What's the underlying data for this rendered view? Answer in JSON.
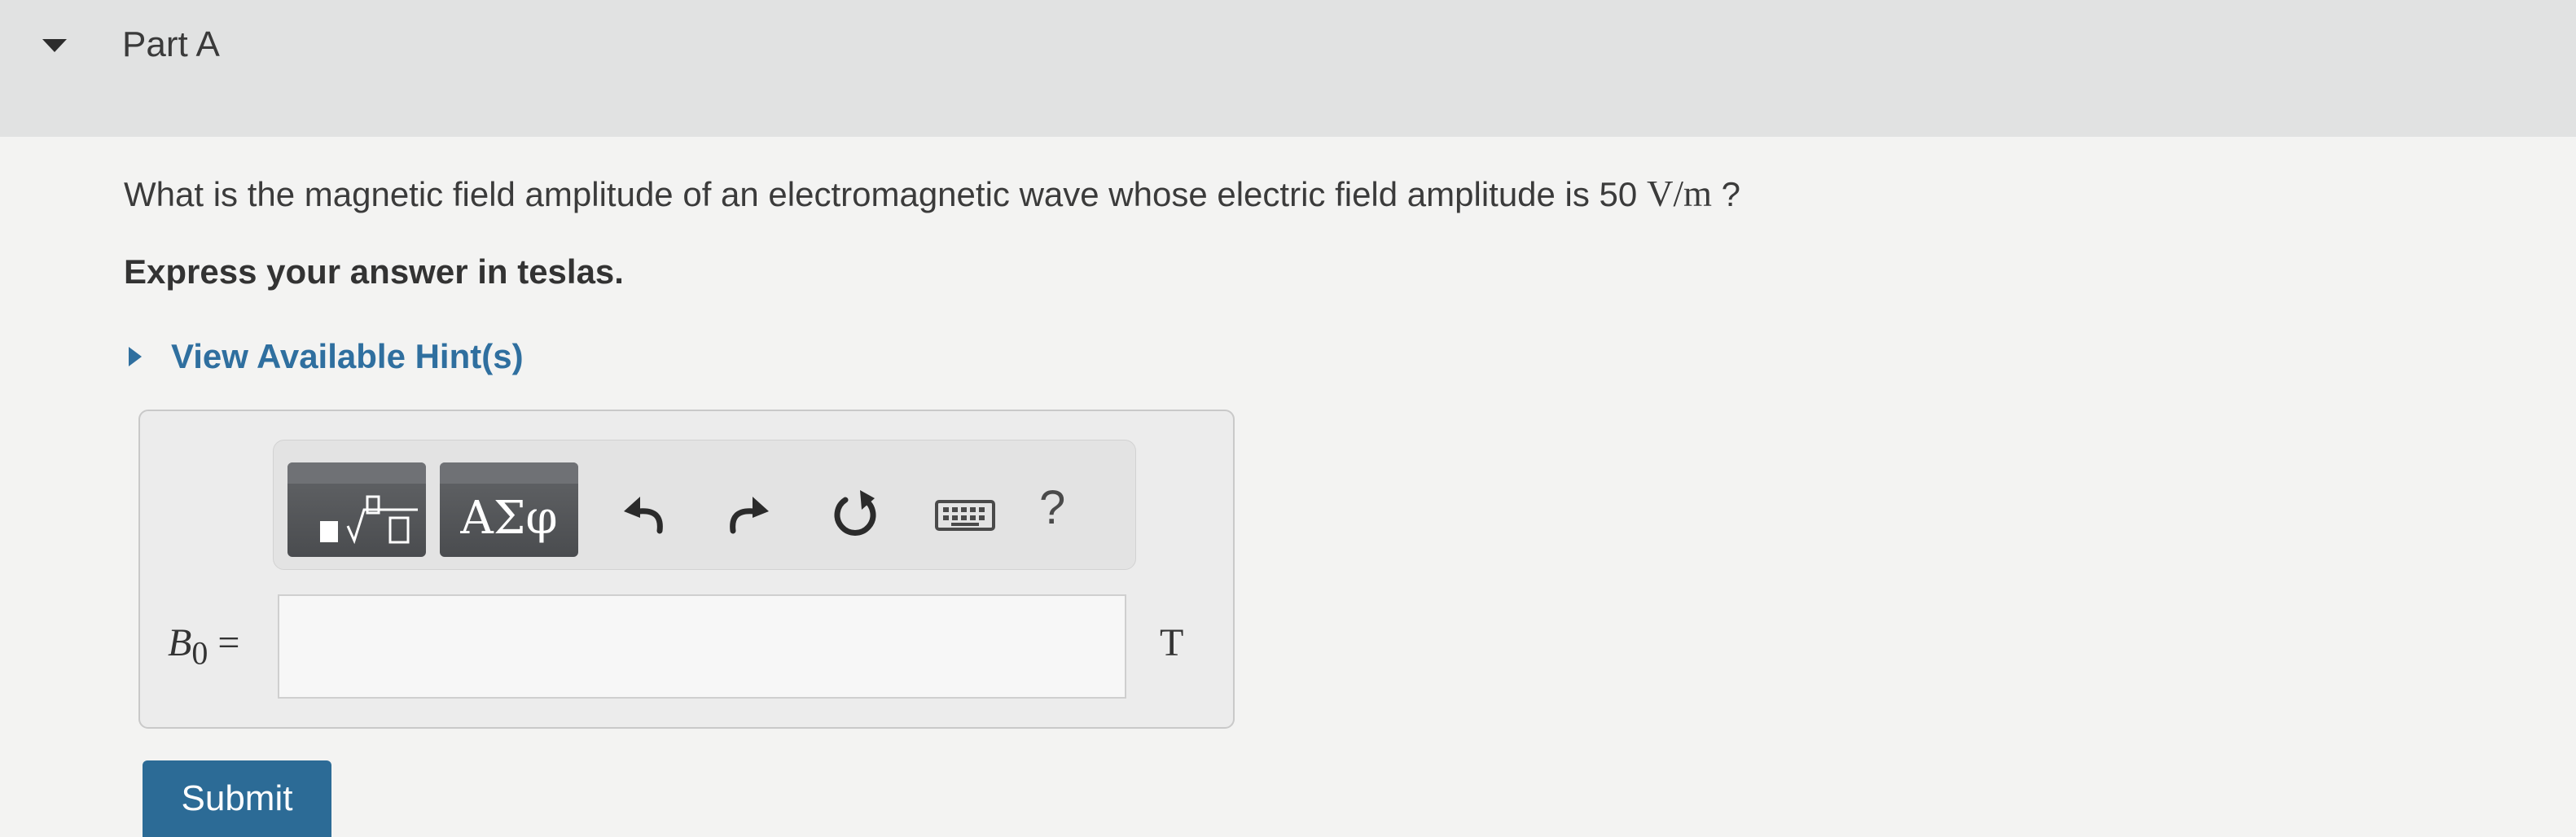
{
  "part": {
    "title": "Part A",
    "toggle_icon": "triangle-down-icon"
  },
  "question": {
    "text_before": "What is the magnetic field amplitude of an electromagnetic wave whose electric field amplitude is 50 ",
    "unit": "V/m",
    "text_after": " ?",
    "instruction": "Express your answer in teslas."
  },
  "hint": {
    "label": "View Available Hint(s)",
    "icon": "triangle-right-icon"
  },
  "toolbar": {
    "templates_icon": "templates-icon",
    "symbols_label": "ΑΣφ",
    "undo_icon": "undo-icon",
    "redo_icon": "redo-icon",
    "reset_icon": "reset-icon",
    "keyboard_icon": "keyboard-icon",
    "help_label": "?"
  },
  "answer": {
    "variable": "B",
    "subscript": "0",
    "equals": "=",
    "value": "",
    "unit": "T"
  },
  "submit": {
    "label": "Submit"
  },
  "colors": {
    "accent": "#2c6b96",
    "hint": "#2f6f9f",
    "toolbar_dark": "#4a4c4f"
  }
}
